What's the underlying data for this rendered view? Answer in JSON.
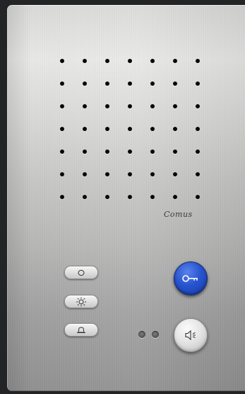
{
  "device": {
    "brand_logo": "Comus",
    "speaker_grille": {
      "rows": 7,
      "cols": 7
    },
    "left_buttons": [
      {
        "icon": "circle-icon"
      },
      {
        "icon": "light-icon"
      },
      {
        "icon": "bell-icon"
      }
    ],
    "door_open_button": {
      "icon": "key-icon",
      "color": "#2754cf"
    },
    "speak_button": {
      "icon": "speaker-icon"
    },
    "indicator_leds": 2
  }
}
